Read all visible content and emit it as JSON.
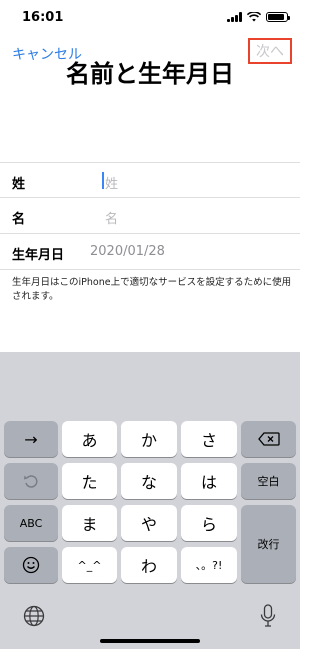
{
  "status": {
    "time": "16:01"
  },
  "nav": {
    "cancel_label": "キャンセル",
    "next_label": "次へ"
  },
  "page": {
    "title": "名前と生年月日"
  },
  "form": {
    "last_name": {
      "label": "姓",
      "placeholder": "姓"
    },
    "first_name": {
      "label": "名",
      "placeholder": "名"
    },
    "birthday": {
      "label": "生年月日",
      "value": "2020/01/28"
    }
  },
  "note": "生年月日はこのiPhone上で適切なサービスを設定するために使用されます。",
  "keyboard": {
    "row1": [
      "→",
      "あ",
      "か",
      "さ"
    ],
    "row2": [
      "た",
      "な",
      "は"
    ],
    "row3": [
      "ABC",
      "ま",
      "や",
      "ら"
    ],
    "row4": [
      "^_^",
      "わ",
      "、。?!"
    ],
    "space_label": "空白",
    "return_label": "改行"
  },
  "colors": {
    "accent": "#2c7de6",
    "highlight_box": "#e8432d",
    "keyboard_bg": "#d2d3d8"
  }
}
